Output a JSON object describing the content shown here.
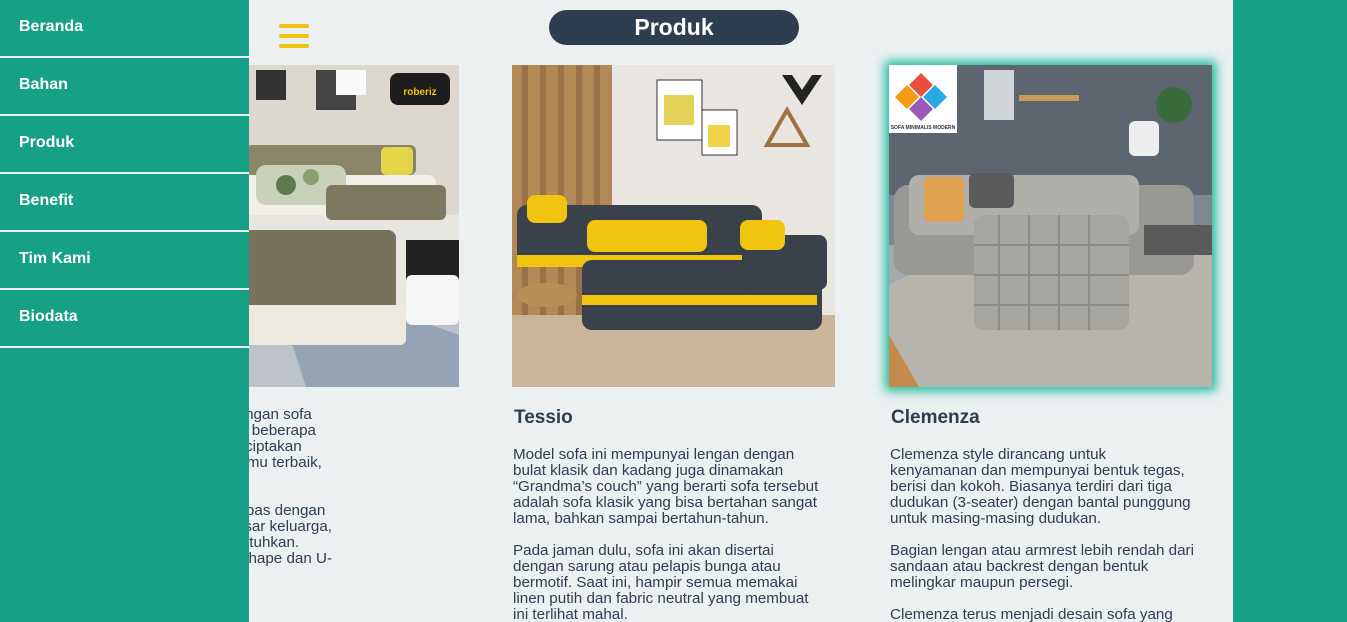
{
  "sidebar": {
    "items": [
      {
        "label": "Beranda"
      },
      {
        "label": "Bahan"
      },
      {
        "label": "Produk"
      },
      {
        "label": "Benefit"
      },
      {
        "label": "Tim Kami"
      },
      {
        "label": "Biodata"
      }
    ]
  },
  "header": {
    "title": "Produk",
    "menu_icon": "hamburger-icon"
  },
  "colors": {
    "accent": "#16a085",
    "dark": "#2c3e50",
    "yellow": "#f1c40f",
    "background": "#ecf0f1"
  },
  "products": [
    {
      "name": "",
      "image_logo": "roberiz",
      "paragraphs": [
        "digabungkan dengan sofa\ng kombinasi dari beberapa\nukan untuk menciptakan\nt duduk ruang tamu terbaik,\neces.",
        "ng dibuat harus pas dengan\nena semakin besar keluarga,\nfa yang kamu butuhkan.\nkenal adalah L-shape dan U-"
      ]
    },
    {
      "name": "Tessio",
      "paragraphs": [
        "Model sofa ini mempunyai lengan dengan\nbulat klasik dan kadang juga dinamakan\n“Grandma’s couch” yang berarti sofa tersebut\nadalah sofa klasik yang bisa bertahan sangat\nlama, bahkan sampai bertahun-tahun.",
        "Pada jaman dulu, sofa ini akan disertai\ndengan sarung atau pelapis bunga atau\nbermotif. Saat ini, hampir semua memakai\nlinen putih dan fabric neutral yang membuat\nini terlihat mahal."
      ]
    },
    {
      "name": "Clemenza",
      "image_logo": "SOFA MINIMALIS MODERN",
      "paragraphs": [
        "Clemenza style dirancang untuk\nkenyamanan dan mempunyai bentuk tegas,\nberisi dan kokoh. Biasanya terdiri dari tiga\ndudukan (3-seater) dengan bantal punggung\nuntuk masing-masing dudukan.",
        "Bagian lengan atau armrest lebih rendah dari\nsandaan atau backrest dengan bentuk\nmelingkar maupun persegi.",
        "Clemenza terus menjadi desain sofa yang"
      ]
    }
  ]
}
